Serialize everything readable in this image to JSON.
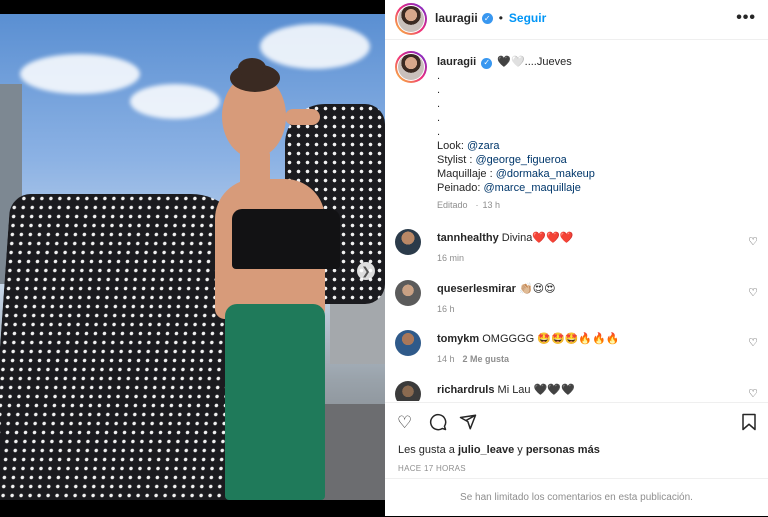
{
  "post": {
    "username": "lauragii",
    "follow_label": "Seguir",
    "more_label": "•••"
  },
  "caption": {
    "username": "lauragii",
    "text_line1": "🖤🤍....Jueves",
    "dots": [
      ".",
      ".",
      ".",
      ".",
      "."
    ],
    "look_label": "Look: ",
    "look_link": "@zara",
    "stylist_label": "Stylist : ",
    "stylist_link": "@george_figueroa",
    "makeup_label": "Maquillaje : ",
    "makeup_link": "@dormaka_makeup",
    "hair_label": "Peinado: ",
    "hair_link": "@marce_maquillaje",
    "edited": "Editado",
    "edited_time": "13 h"
  },
  "comments": [
    {
      "username": "tannhealthy",
      "text": "Divina❤️❤️❤️",
      "time": "16 min",
      "likes": ""
    },
    {
      "username": "queserlesmirar",
      "text": "👏🏼😍😍",
      "time": "16 h",
      "likes": ""
    },
    {
      "username": "tomykm",
      "text": "OMGGGG 🤩🤩🤩🔥🔥🔥",
      "time": "14 h",
      "likes": "2 Me gusta"
    },
    {
      "username": "richardruls",
      "text": "Mi Lau 🖤🖤🖤",
      "time": "",
      "likes": ""
    }
  ],
  "likes": {
    "prefix": "Les gusta a ",
    "user": "julio_leave",
    "join": " y ",
    "others": "personas más"
  },
  "timestamp": "HACE 17 HORAS",
  "limited_notice": "Se han limitado los comentarios en esta publicación.",
  "icons": {
    "heart": "heart-icon",
    "comment": "comment-icon",
    "share": "share-icon",
    "save": "bookmark-icon",
    "next": "chevron-right-icon",
    "verified": "verified-badge-icon"
  },
  "colors": {
    "accent": "#0095f6",
    "verified": "#3897f0",
    "link": "#00376b",
    "muted": "#8e8e8e"
  }
}
